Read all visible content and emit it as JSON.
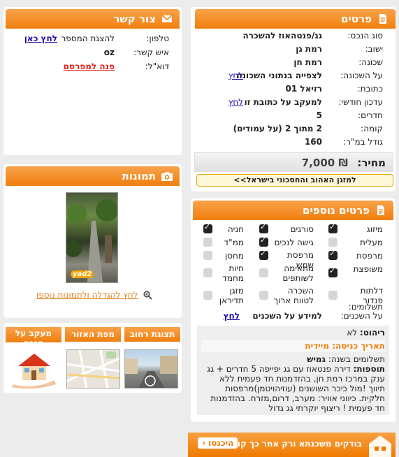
{
  "details": {
    "title": "פרטים",
    "rows": [
      {
        "label": "סוג הנכס:",
        "value": "גג/פנטהאוז להשכרה",
        "bold": true
      },
      {
        "label": "ישוב:",
        "value": "רמת גן",
        "bold": true
      },
      {
        "label": "שכונה:",
        "value": "רמת חן",
        "bold": true
      },
      {
        "label": "על השכונה:",
        "value": "לצפייה בנתוני השכונה",
        "link": "לחץ"
      },
      {
        "label": "כתובת:",
        "value": "רזיאל 01",
        "bold": true
      },
      {
        "label": "עדכון חודשי:",
        "value": "למעקב על כתובת זו",
        "link": "לחץ"
      },
      {
        "label": "חדרים:",
        "value": "5",
        "bold": true
      },
      {
        "label": "קומה:",
        "value": "2 מתוך 2 (על עמודים)",
        "bold": true
      },
      {
        "label": "גודל במ\"ר:",
        "value": "160",
        "bold": true
      }
    ],
    "price_label": "מחיר:",
    "price_value": "7,000 ₪",
    "ac_banner": "למזגן האהוב והחסכוני בישראל>>"
  },
  "contact": {
    "title": "צור קשר",
    "phone_label": "טלפון:",
    "phone_text": "להצגת המספר",
    "phone_link": "לחץ כאן",
    "person_label": "איש קשר:",
    "person_value": "oz",
    "email_label": "דוא\"ל:",
    "email_link": "פנה למפרסם"
  },
  "photos": {
    "title": "תמונות",
    "enlarge_link": "לחץ להגדלה ולתמונות נוספו",
    "watermark": "yad2"
  },
  "extra": {
    "title": "פרטים נוספים",
    "features": [
      {
        "label": "מיזוג",
        "checked": true
      },
      {
        "label": "סורגים",
        "checked": true
      },
      {
        "label": "חניה",
        "checked": true
      },
      {
        "label": "מעלית",
        "checked": false
      },
      {
        "label": "גישה לנכים",
        "checked": true
      },
      {
        "label": "ממ\"ד",
        "checked": false
      },
      {
        "label": "מרפסת",
        "checked": true
      },
      {
        "label": "מרפסת שמש",
        "checked": true
      },
      {
        "label": "מחסן",
        "checked": false
      },
      {
        "label": "משופצת",
        "checked": true
      },
      {
        "label": "מתאימה לשותפים",
        "checked": false
      },
      {
        "label": "חיות מחמד",
        "checked": false
      },
      {
        "label": "דלתות פנדור",
        "checked": false
      },
      {
        "label": "השכרה לטווח ארוך",
        "checked": false
      },
      {
        "label": "מזגן תדיראן",
        "checked": false
      }
    ],
    "payments_label": "תשלומים:",
    "neighbors_label": "על השכנים:",
    "neighbors_text": "למידע על השכנים",
    "neighbors_link": "לחץ",
    "furniture_label": "ריהוט:",
    "furniture_value": "לא",
    "entry_label": "תאריך כניסה:",
    "entry_value": "מיידית",
    "pay_count_label": "תשלומים בשנה:",
    "pay_count_value": "גמיש",
    "additions_label": "תוספות:",
    "additions_text": "דירה פנטאוז עם גג יפייפה 5 חדרים + גג ענק במרכז רמת חן, בהזדמנות חד פעמית ללא תיווך !מול כיכר השושנים (עוזיהויטמן)מרפסות חלקית. כיווני אוויר: מערב, דרום,מזרח. בהזדמנות חד פעמית ! ריצוף יוקרתי גג גדול"
  },
  "tabs": {
    "street_view": "תצוגת רחוב",
    "area_map": "מפת האזור",
    "tracking": "מעקב על הנכס"
  },
  "bottom_banner": {
    "text": "בודקים משכנתא ורק אחר כך קונים",
    "cta": "היכנסו"
  },
  "colors": {
    "orange": "#f07f0e",
    "link": "#1a0dab",
    "red": "#e0221a"
  }
}
